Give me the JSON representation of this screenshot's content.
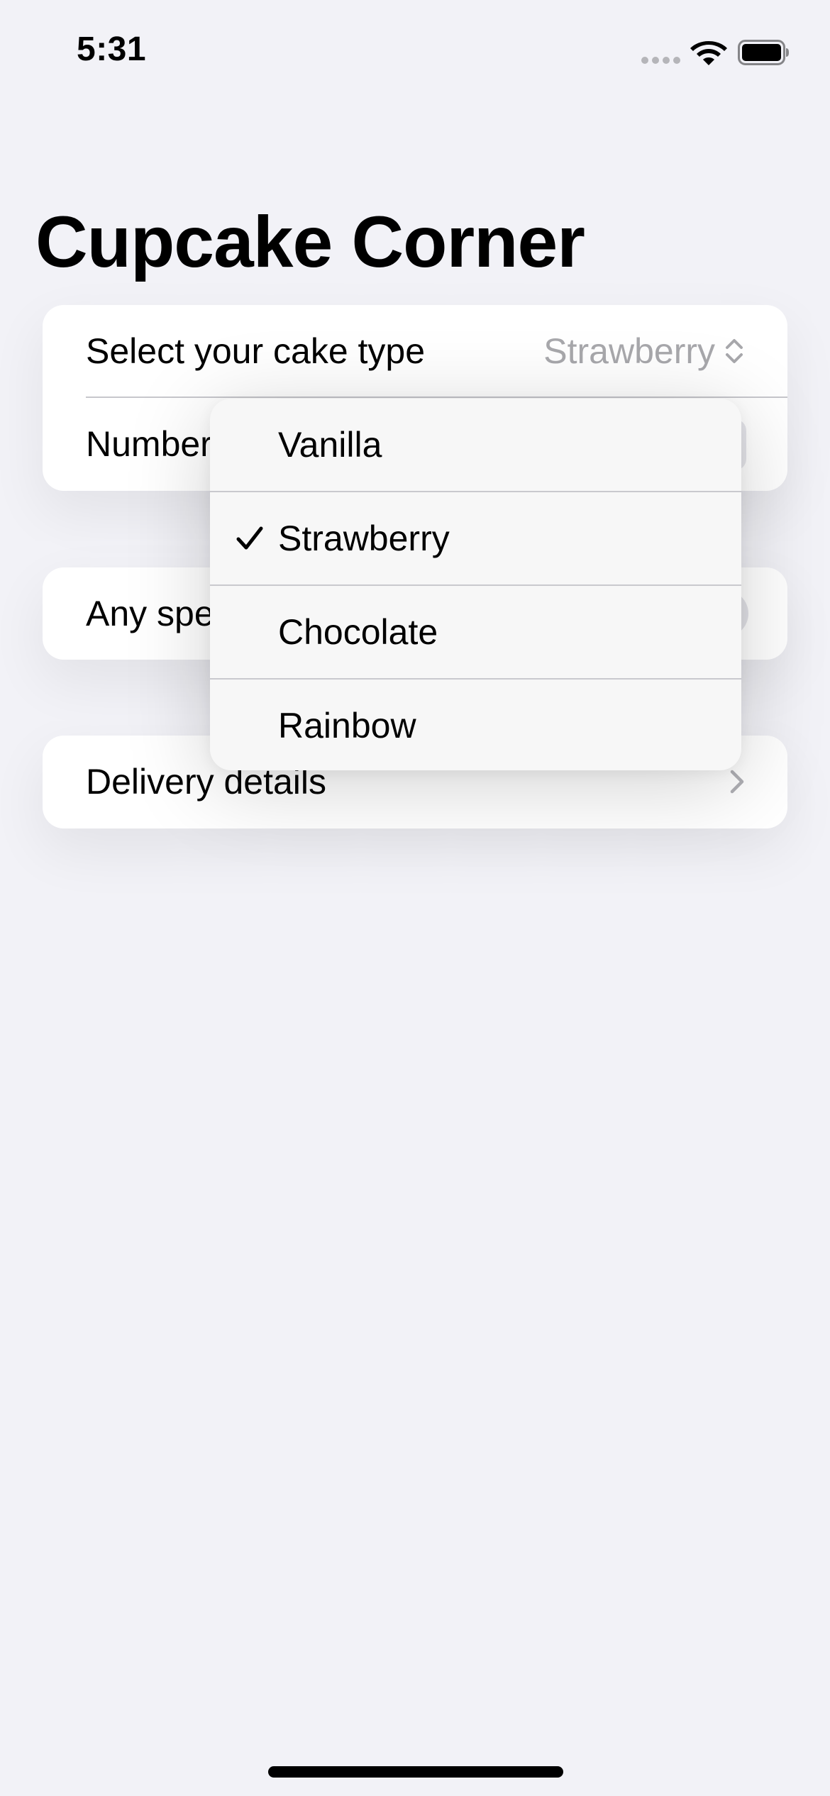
{
  "status_bar": {
    "time": "5:31"
  },
  "page": {
    "title": "Cupcake Corner"
  },
  "form": {
    "cake_type_row": {
      "label": "Select your cake type",
      "selected_value": "Strawberry"
    },
    "number_row": {
      "label": "Number"
    },
    "special_row": {
      "label": "Any spe"
    },
    "delivery_row": {
      "label": "Delivery details"
    }
  },
  "menu": {
    "items": [
      {
        "label": "Vanilla",
        "selected": false
      },
      {
        "label": "Strawberry",
        "selected": true
      },
      {
        "label": "Chocolate",
        "selected": false
      },
      {
        "label": "Rainbow",
        "selected": false
      }
    ]
  },
  "icons": {
    "wifi": "wifi-icon",
    "battery": "battery-icon",
    "picker": "up-down-chevron-icon",
    "disclosure": "chevron-right-icon",
    "check": "checkmark-icon"
  },
  "colors": {
    "background": "#F2F2F7",
    "card": "#FFFFFF",
    "secondary_text": "#A8A8AC",
    "menu_background": "#F7F7F7"
  }
}
